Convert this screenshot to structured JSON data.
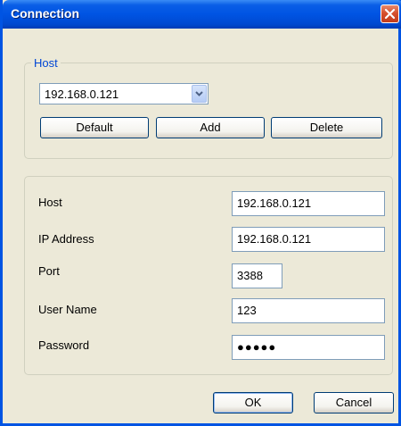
{
  "window": {
    "title": "Connection",
    "close_icon": "close-icon"
  },
  "host_group": {
    "legend": "Host",
    "combo_value": "192.168.0.121",
    "buttons": {
      "default": "Default",
      "add": "Add",
      "delete": "Delete"
    }
  },
  "form": {
    "host_label": "Host",
    "host_value": "192.168.0.121",
    "ip_label": "IP Address",
    "ip_value": "192.168.0.121",
    "port_label": "Port",
    "port_value": "3388",
    "user_label": "User Name",
    "user_value": "123",
    "password_label": "Password",
    "password_value": "●●●●●"
  },
  "footer": {
    "ok": "OK",
    "cancel": "Cancel"
  },
  "colors": {
    "titlebar": "#0054e3",
    "window_bg": "#ece9d8",
    "legend": "#0046d5",
    "close_button": "#d6502e"
  }
}
